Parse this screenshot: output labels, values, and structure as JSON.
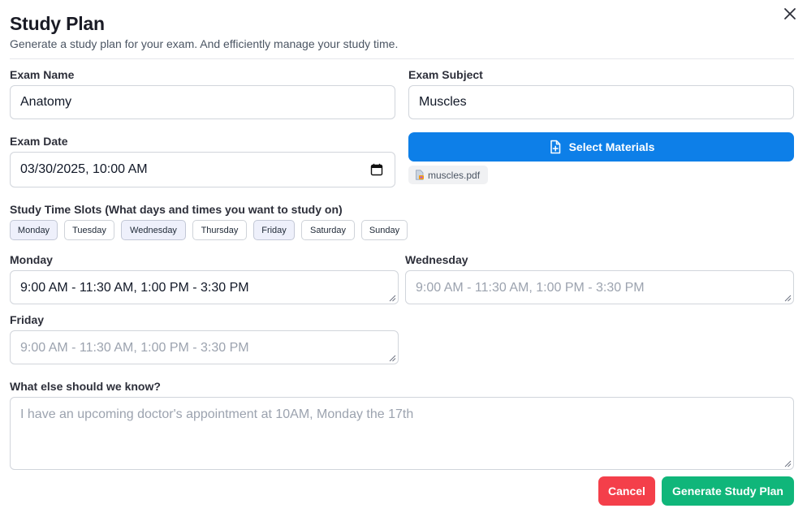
{
  "header": {
    "title": "Study Plan",
    "subtitle": "Generate a study plan for your exam. And efficiently manage your study time."
  },
  "exam_name": {
    "label": "Exam Name",
    "value": "Anatomy"
  },
  "exam_subject": {
    "label": "Exam Subject",
    "value": "Muscles"
  },
  "exam_date": {
    "label": "Exam Date",
    "value": "03/30/2025, 10:00 AM"
  },
  "materials": {
    "button_label": "Select Materials",
    "file_name": "muscles.pdf"
  },
  "time_slots": {
    "label": "Study Time Slots (What days and times you want to study on)",
    "days": [
      {
        "label": "Monday",
        "selected": true
      },
      {
        "label": "Tuesday",
        "selected": false
      },
      {
        "label": "Wednesday",
        "selected": true
      },
      {
        "label": "Thursday",
        "selected": false
      },
      {
        "label": "Friday",
        "selected": true
      },
      {
        "label": "Saturday",
        "selected": false
      },
      {
        "label": "Sunday",
        "selected": false
      }
    ],
    "monday": {
      "label": "Monday",
      "value": "9:00 AM - 11:30 AM, 1:00 PM - 3:30 PM"
    },
    "wednesday": {
      "label": "Wednesday",
      "placeholder": "9:00 AM - 11:30 AM, 1:00 PM - 3:30 PM"
    },
    "friday": {
      "label": "Friday",
      "placeholder": "9:00 AM - 11:30 AM, 1:00 PM - 3:30 PM"
    }
  },
  "notes": {
    "label": "What else should we know?",
    "placeholder": "I have an upcoming doctor's appointment at 10AM, Monday the 17th"
  },
  "actions": {
    "cancel_label": "Cancel",
    "generate_label": "Generate Study Plan"
  },
  "colors": {
    "primary": "#0d7fe8",
    "cancel": "#f43f4a",
    "generate": "#10b67a"
  }
}
